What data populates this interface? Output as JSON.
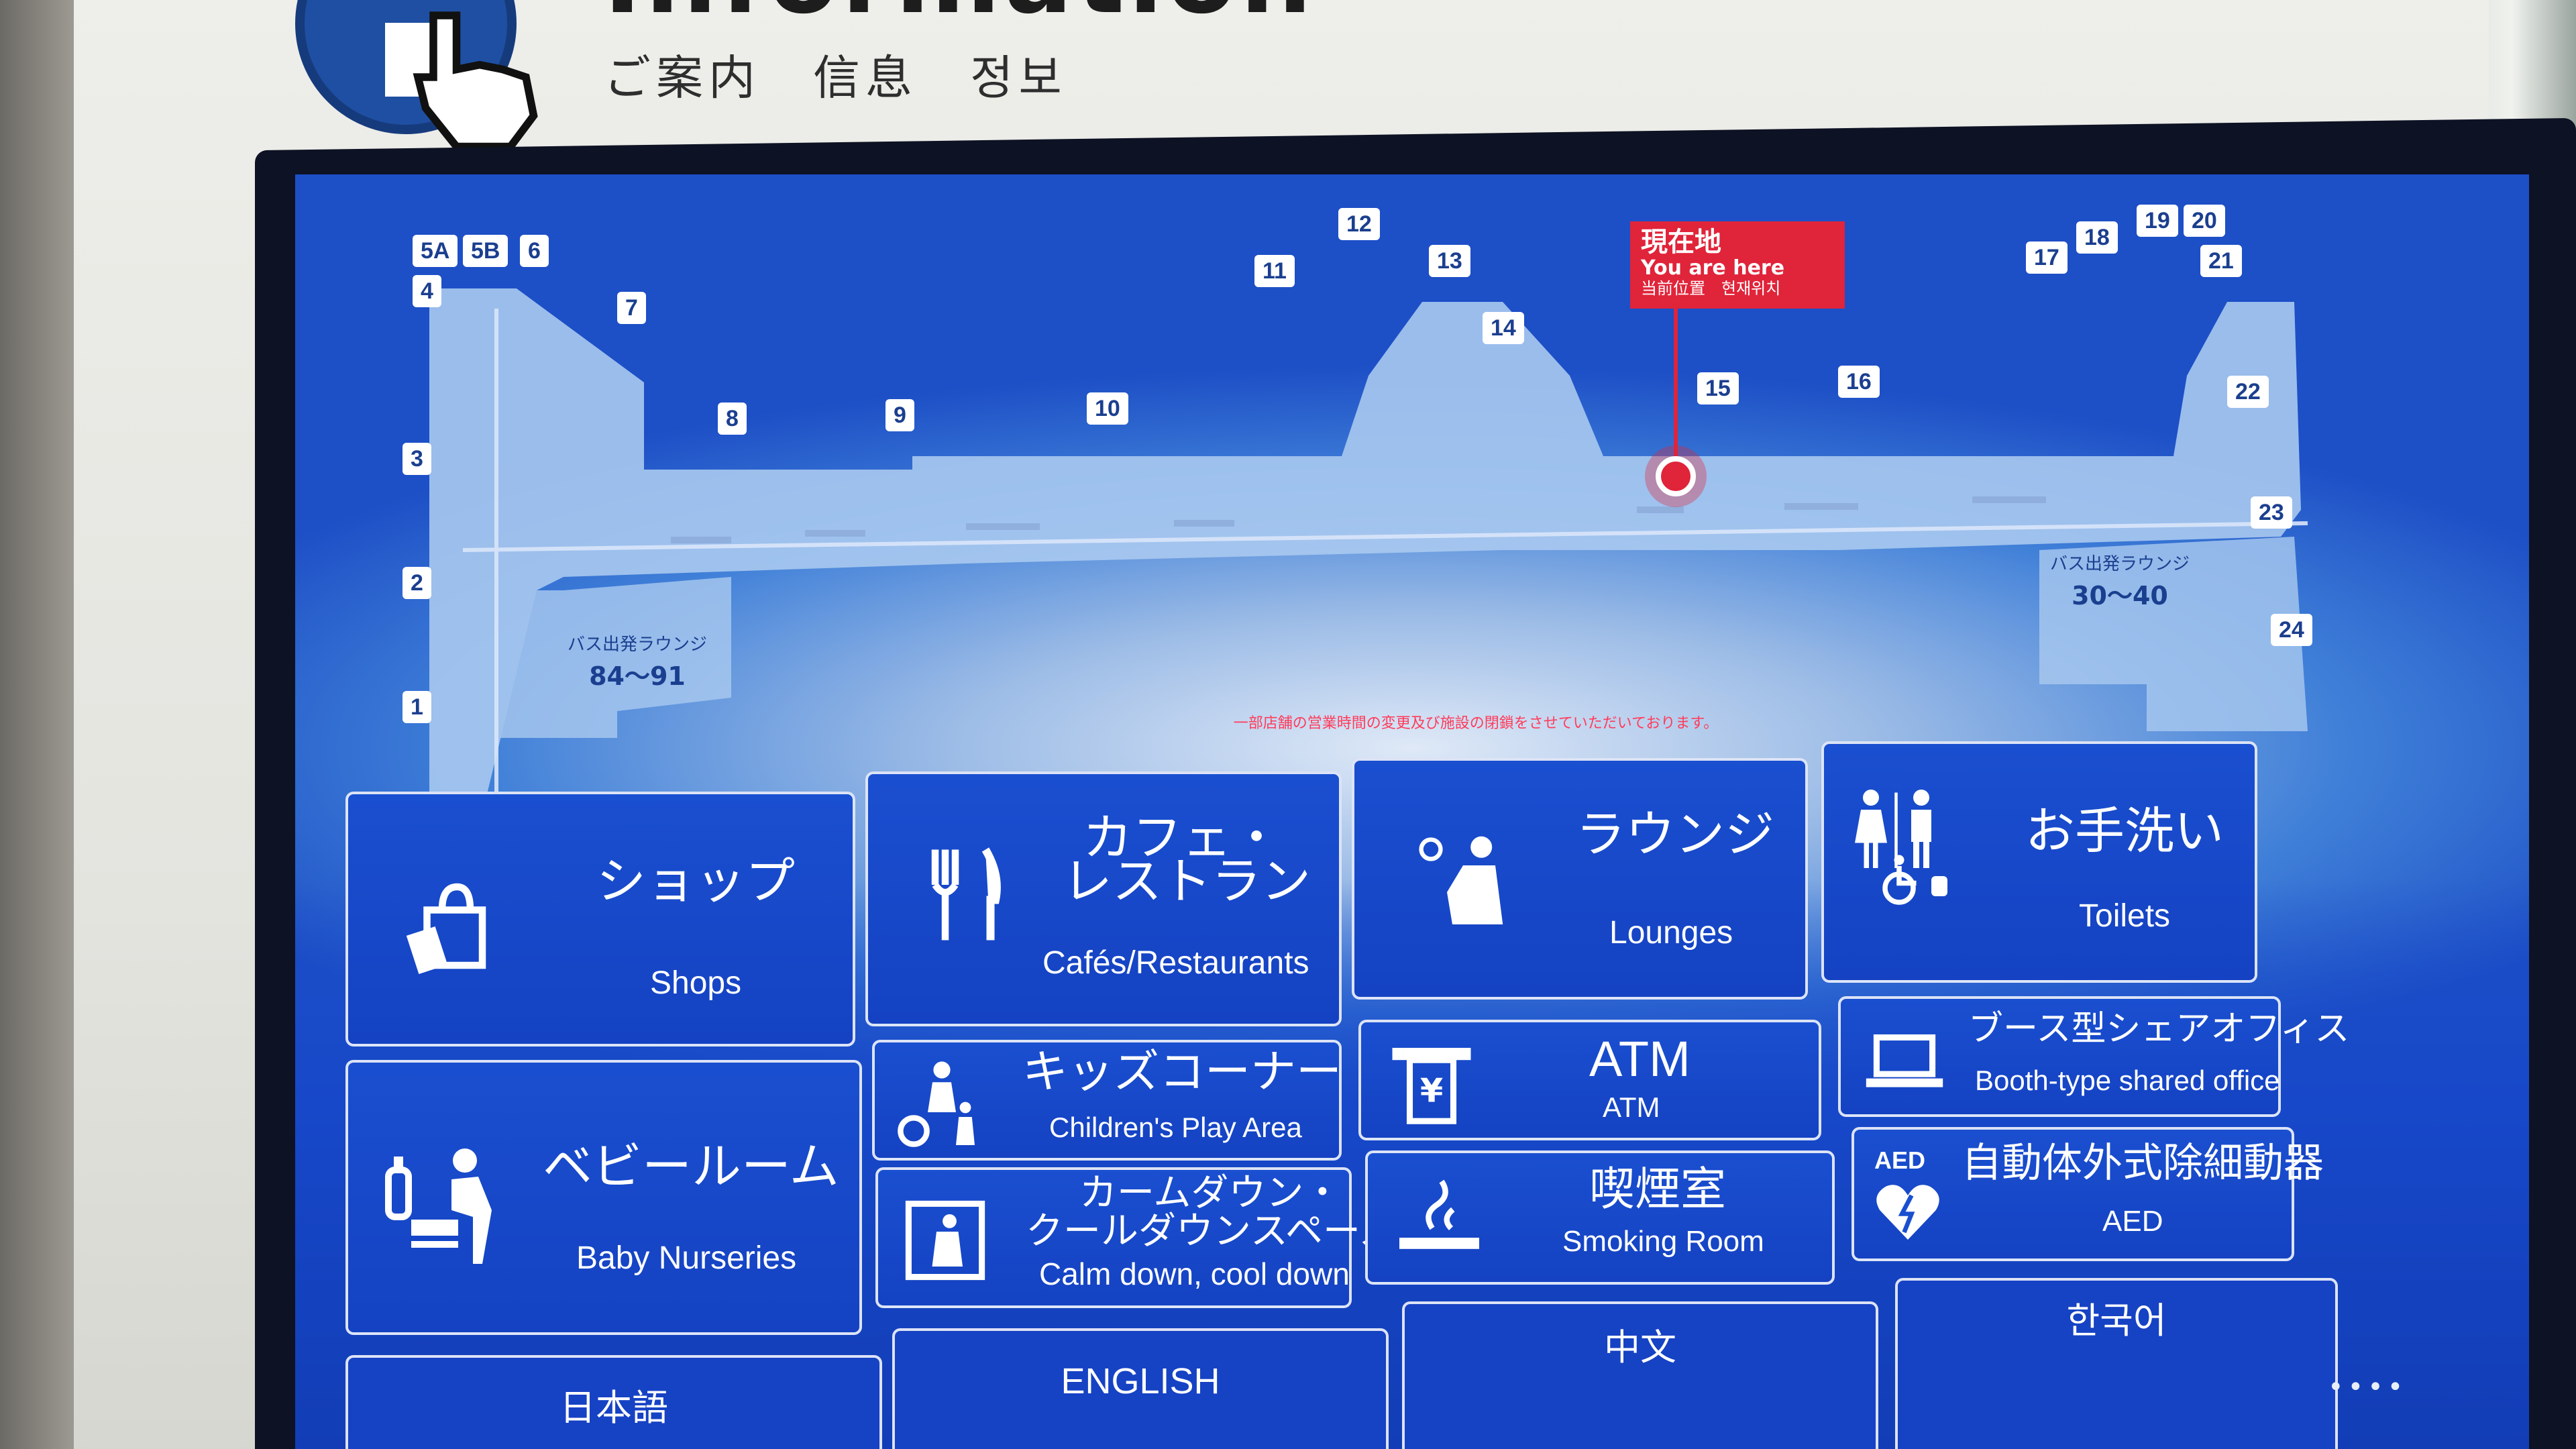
{
  "header": {
    "title_partial": "Information",
    "subtitle": "ご案内　信息　정보"
  },
  "map": {
    "gates": [
      "5A",
      "5B",
      "6",
      "4",
      "7",
      "3",
      "8",
      "9",
      "10",
      "11",
      "12",
      "13",
      "14",
      "15",
      "16",
      "17",
      "18",
      "19",
      "20",
      "21",
      "22",
      "23",
      "24",
      "2",
      "1"
    ],
    "you_are_here": {
      "line1": "現在地",
      "line2": "You are here",
      "line3": "当前位置　현재위치"
    },
    "bus_lounge_left": {
      "label": "バス出発ラウンジ",
      "range": "84〜91"
    },
    "bus_lounge_right": {
      "label": "バス出発ラウンジ",
      "range": "30〜40"
    }
  },
  "notice": "一部店舗の営業時間の変更及び施設の閉鎖をさせていただいております。",
  "tiles": {
    "shops": {
      "jp": "ショップ",
      "en": "Shops",
      "icon": "shopping-bag-icon"
    },
    "cafes": {
      "jp1": "カフェ・",
      "jp2": "レストラン",
      "en": "Cafés/Restaurants",
      "icon": "fork-knife-icon"
    },
    "lounges": {
      "jp": "ラウンジ",
      "en": "Lounges",
      "icon": "lounge-seat-icon"
    },
    "toilets": {
      "jp": "お手洗い",
      "en": "Toilets",
      "icon": "restroom-icon"
    },
    "kids": {
      "jp": "キッズコーナー",
      "en": "Children's Play Area",
      "icon": "kids-play-icon"
    },
    "atm": {
      "jp": "ATM",
      "en": "ATM",
      "icon": "atm-icon"
    },
    "booth": {
      "jp": "ブース型シェアオフィス",
      "en": "Booth-type shared office",
      "icon": "laptop-icon"
    },
    "baby": {
      "jp": "ベビールーム",
      "en": "Baby Nurseries",
      "icon": "baby-nursery-icon"
    },
    "calm": {
      "jp1": "カームダウン・",
      "jp2": "クールダウンスペース",
      "en": "Calm down, cool down",
      "icon": "calm-space-icon"
    },
    "smoking": {
      "jp": "喫煙室",
      "en": "Smoking Room",
      "icon": "smoking-icon"
    },
    "aed": {
      "jp": "自動体外式除細動器",
      "en": "AED",
      "badge": "AED",
      "icon": "aed-heart-icon"
    }
  },
  "languages": [
    "日本語",
    "ENGLISH",
    "中文",
    "한국어"
  ],
  "colors": {
    "tile_blue": "#1a4fd0",
    "marker_red": "#e0243a",
    "kiosk_frame": "#eeeeea"
  }
}
